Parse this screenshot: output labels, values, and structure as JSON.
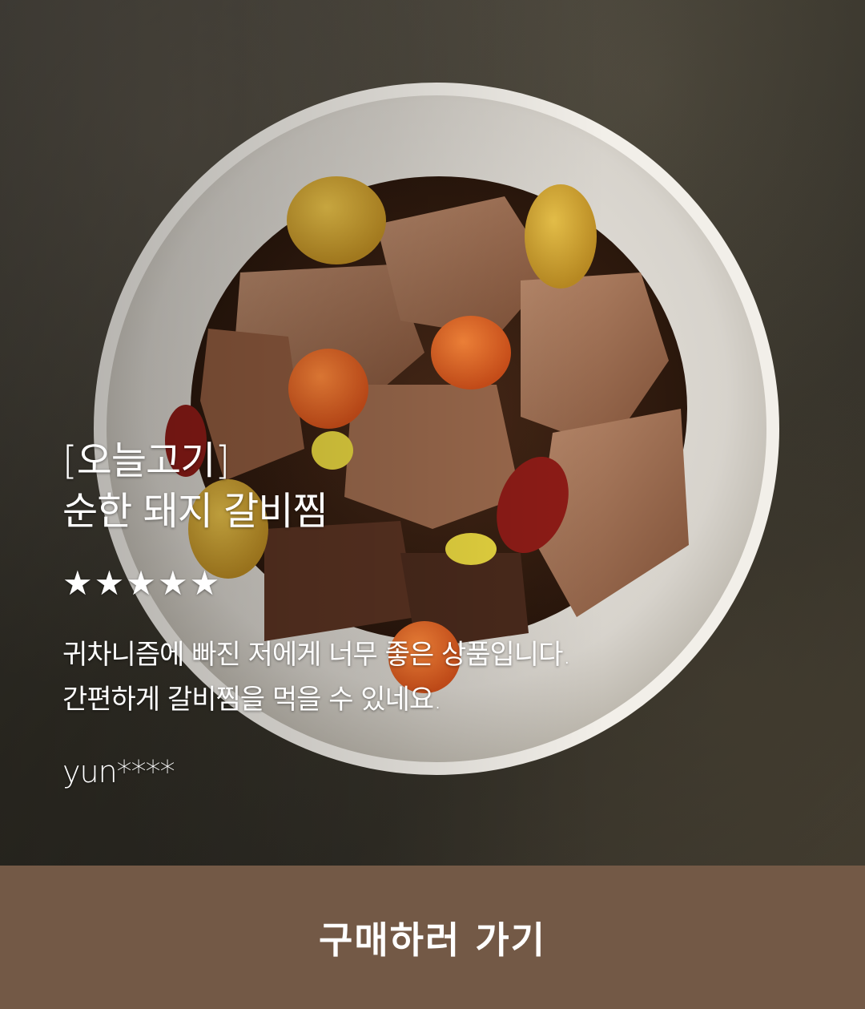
{
  "review": {
    "brand": "[오늘고기]",
    "product": "순한 돼지 갈비찜",
    "stars": "★★★★★",
    "body_line1": "귀차니즘에 빠진 저에게 너무 좋은 상품입니다.",
    "body_line2": "간편하게 갈비찜을 먹을 수 있네요.",
    "reviewer": "yun****"
  },
  "cta": {
    "label": "구매하러 가기",
    "color": "#735946"
  }
}
